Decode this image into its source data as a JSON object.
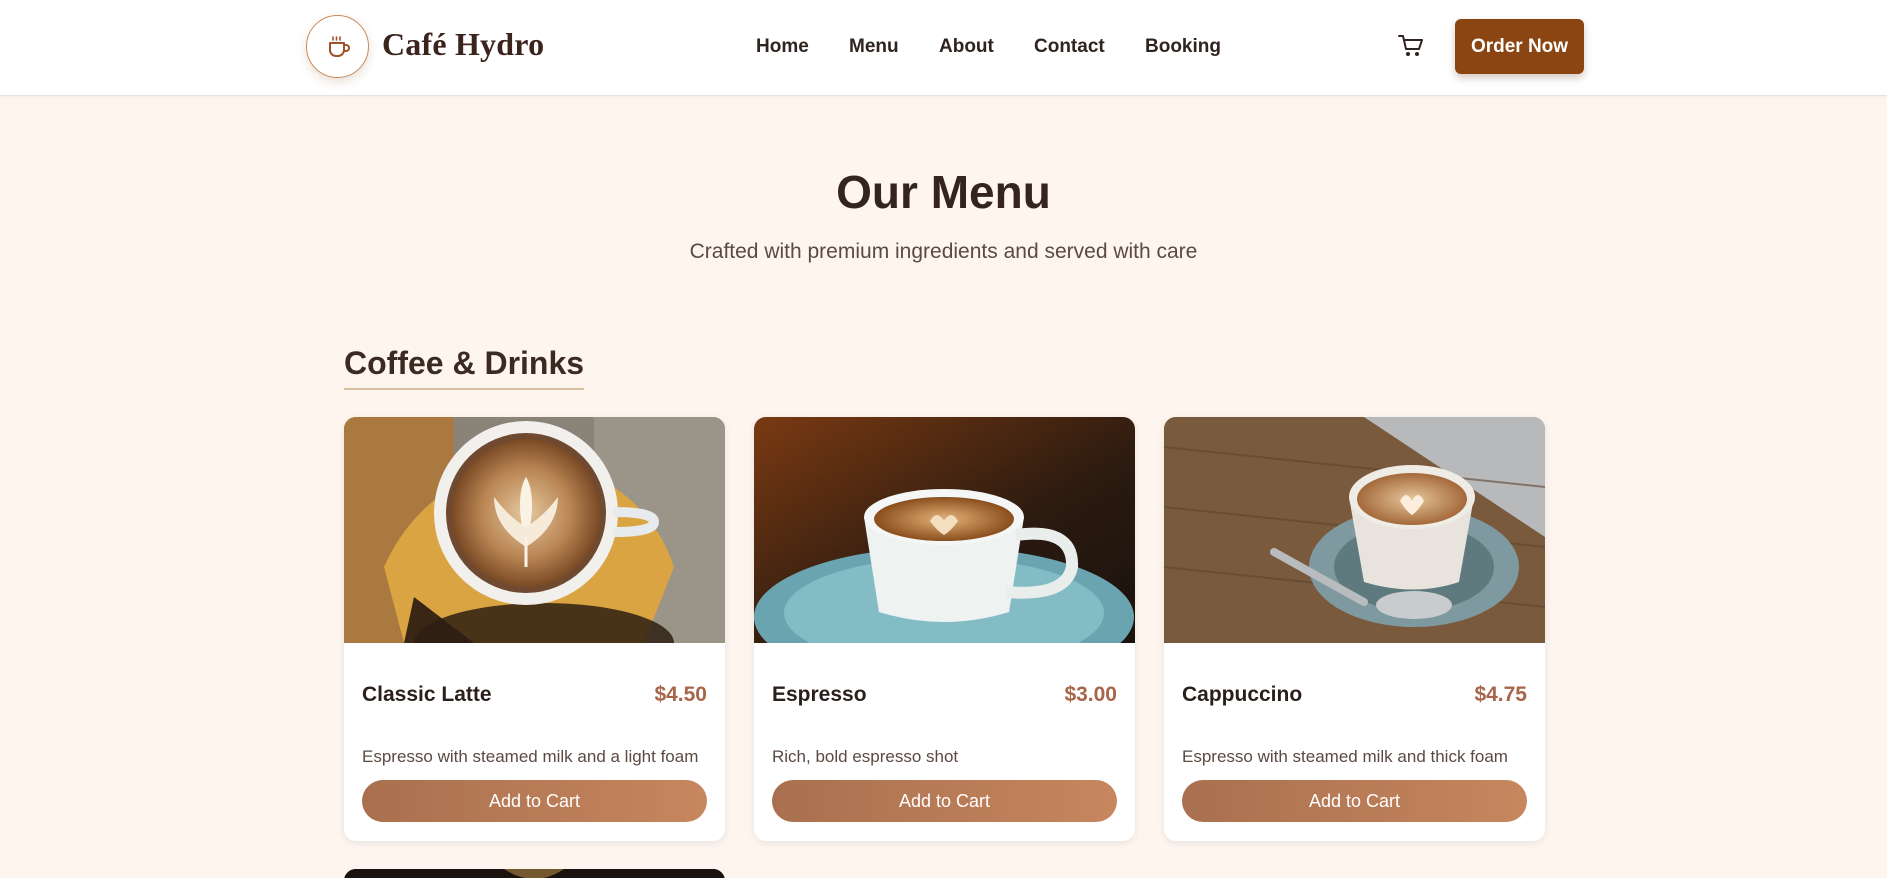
{
  "header": {
    "brand": "Café Hydro",
    "logo_icon": "coffee-cup-icon",
    "nav": [
      {
        "label": "Home"
      },
      {
        "label": "Menu"
      },
      {
        "label": "About"
      },
      {
        "label": "Contact"
      },
      {
        "label": "Booking"
      }
    ],
    "cart_icon": "cart-icon",
    "order_button": "Order Now"
  },
  "hero": {
    "title": "Our Menu",
    "subtitle": "Crafted with premium ingredients and served with care"
  },
  "section": {
    "title": "Coffee & Drinks"
  },
  "items": [
    {
      "name": "Classic Latte",
      "price": "$4.50",
      "description": "Espresso with steamed milk and a light foam",
      "button": "Add to Cart"
    },
    {
      "name": "Espresso",
      "price": "$3.00",
      "description": "Rich, bold espresso shot",
      "button": "Add to Cart"
    },
    {
      "name": "Cappuccino",
      "price": "$4.75",
      "description": "Espresso with steamed milk and thick foam",
      "button": "Add to Cart"
    }
  ],
  "colors": {
    "background": "#fdf5ee",
    "brand": "#8b4513",
    "price": "#a8654a",
    "button_gradient_start": "#a9704f",
    "button_gradient_end": "#c7865e"
  }
}
